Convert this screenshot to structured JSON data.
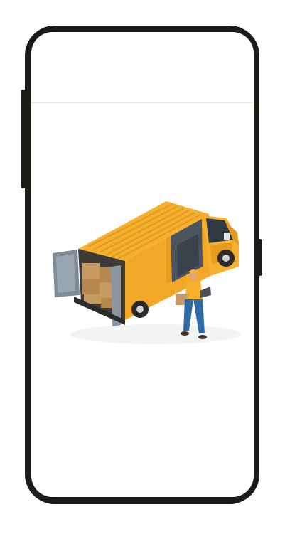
{
  "screen": {
    "illustration": "delivery-van-with-courier",
    "colors": {
      "frame": "#1b1b17",
      "van_body": "#f5b02e",
      "van_shadow": "#d88f1c",
      "van_roof_ribs": "#e39a22",
      "boxes": "#c89a63",
      "door": "#7f8c98",
      "courier_shirt": "#f5b02e",
      "courier_pants": "#2f6aa6"
    }
  }
}
